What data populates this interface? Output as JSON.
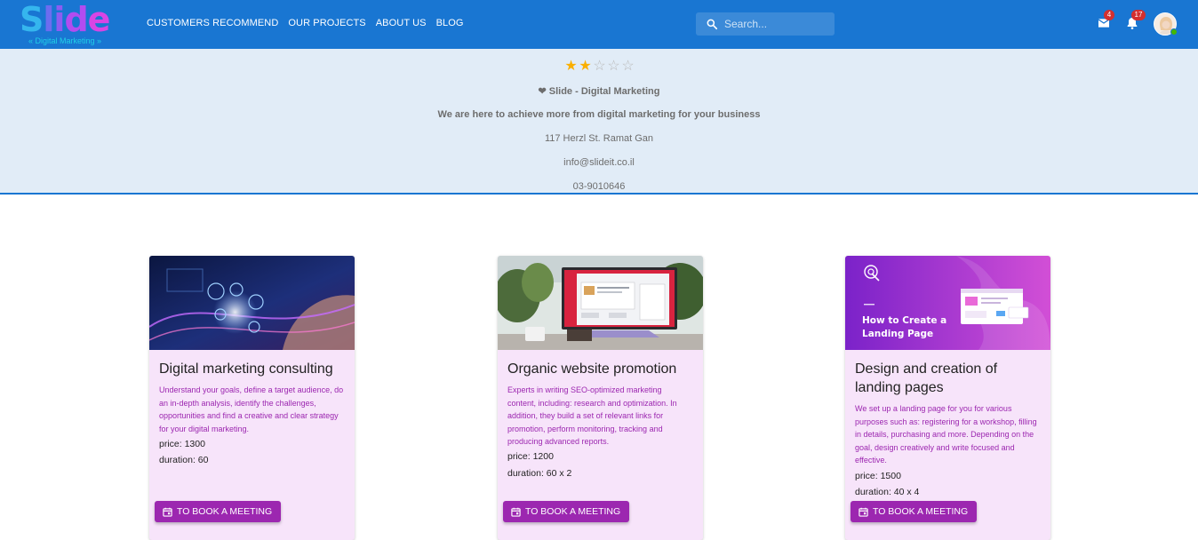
{
  "header": {
    "logo_text": "Slide",
    "logo_subtitle": "« Digital Marketing »",
    "nav": [
      "CUSTOMERS RECOMMEND",
      "OUR PROJECTS",
      "ABOUT US",
      "BLOG"
    ],
    "search_placeholder": "Search...",
    "mail_count": "4",
    "notification_count": "17",
    "bar_color": "#1976d2"
  },
  "business": {
    "rating": 2,
    "rating_max": 5,
    "name": "Slide - Digital Marketing",
    "tagline": "We are here to achieve more from digital marketing for your business",
    "address": "117 Herzl St. Ramat Gan",
    "email": "info@slideit.co.il",
    "phone": "03-9010646"
  },
  "services": [
    {
      "title": "Digital marketing consulting",
      "description": "Understand your goals, define a target audience, do an in-depth analysis, identify the challenges, opportunities and find a creative and clear strategy for your digital marketing.",
      "price": "price: 1300",
      "duration": "duration: 60",
      "button": "TO BOOK A MEETING"
    },
    {
      "title": "Organic website promotion",
      "description": "Experts in writing SEO-optimized marketing content, including: research and optimization. In addition, they build a set of relevant links for promotion, perform monitoring, tracking and producing advanced reports.",
      "price": "price: 1200",
      "duration": "duration: 60 x 2",
      "button": "TO BOOK A MEETING"
    },
    {
      "title": "Design and creation of landing pages",
      "description": "We set up a landing page for you for various purposes such as: registering for a workshop, filling in details, purchasing and more. Depending on the goal, design creatively and write focused and effective.",
      "price": "price: 1500",
      "duration": "duration: 40 x 4",
      "button": "TO BOOK A MEETING",
      "image_caption": "How to Create a Landing Page"
    }
  ],
  "colors": {
    "accent": "#9c27b0",
    "banner_bg": "#e1ecf7",
    "card_bg": "#f7e4fa",
    "star": "#faaf00"
  }
}
